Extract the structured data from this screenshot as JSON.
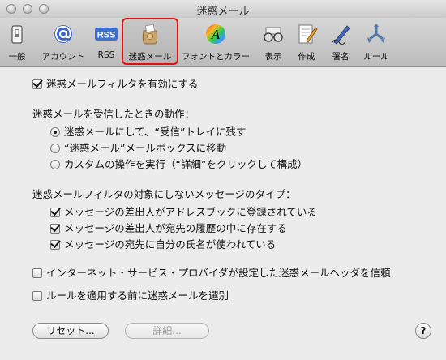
{
  "window": {
    "title": "迷惑メール"
  },
  "toolbar": {
    "items": [
      {
        "label": "一般",
        "icon": "switch-icon"
      },
      {
        "label": "アカウント",
        "icon": "at-sign-icon"
      },
      {
        "label": "RSS",
        "icon": "rss-icon",
        "icon_text": "RSS"
      },
      {
        "label": "迷惑メール",
        "icon": "junk-mail-bag-icon",
        "selected": true
      },
      {
        "label": "フォントとカラー",
        "icon": "font-color-icon",
        "icon_text": "A"
      },
      {
        "label": "表示",
        "icon": "glasses-icon"
      },
      {
        "label": "作成",
        "icon": "compose-icon"
      },
      {
        "label": "署名",
        "icon": "signature-pen-icon"
      },
      {
        "label": "ルール",
        "icon": "rules-icon"
      }
    ]
  },
  "junk": {
    "enable": {
      "label": "迷惑メールフィルタを有効にする",
      "checked": true
    },
    "action_heading": "迷惑メールを受信したときの動作：",
    "actions": [
      {
        "label": "迷惑メールにして、“受信”トレイに残す",
        "selected": true
      },
      {
        "label": "“迷惑メール”メールボックスに移動",
        "selected": false
      },
      {
        "label": "カスタムの操作を実行（“詳細”をクリックして構成）",
        "selected": false
      }
    ],
    "exempt_heading": "迷惑メールフィルタの対象にしないメッセージのタイプ：",
    "exemptions": [
      {
        "label": "メッセージの差出人がアドレスブックに登録されている",
        "checked": true
      },
      {
        "label": "メッセージの差出人が宛先の履歴の中に存在する",
        "checked": true
      },
      {
        "label": "メッセージの宛先に自分の氏名が使われている",
        "checked": true
      }
    ],
    "trust_headers": {
      "label": "インターネット・サービス・プロバイダが設定した迷惑メールヘッダを信頼",
      "checked": false
    },
    "filter_before_rules": {
      "label": "ルールを適用する前に迷惑メールを選別",
      "checked": false
    }
  },
  "buttons": {
    "reset": "リセット...",
    "advanced": "詳細...",
    "help": "?"
  },
  "colors": {
    "selected_outline": "#e01010",
    "toolbar_bg": "#c8c8c8"
  }
}
